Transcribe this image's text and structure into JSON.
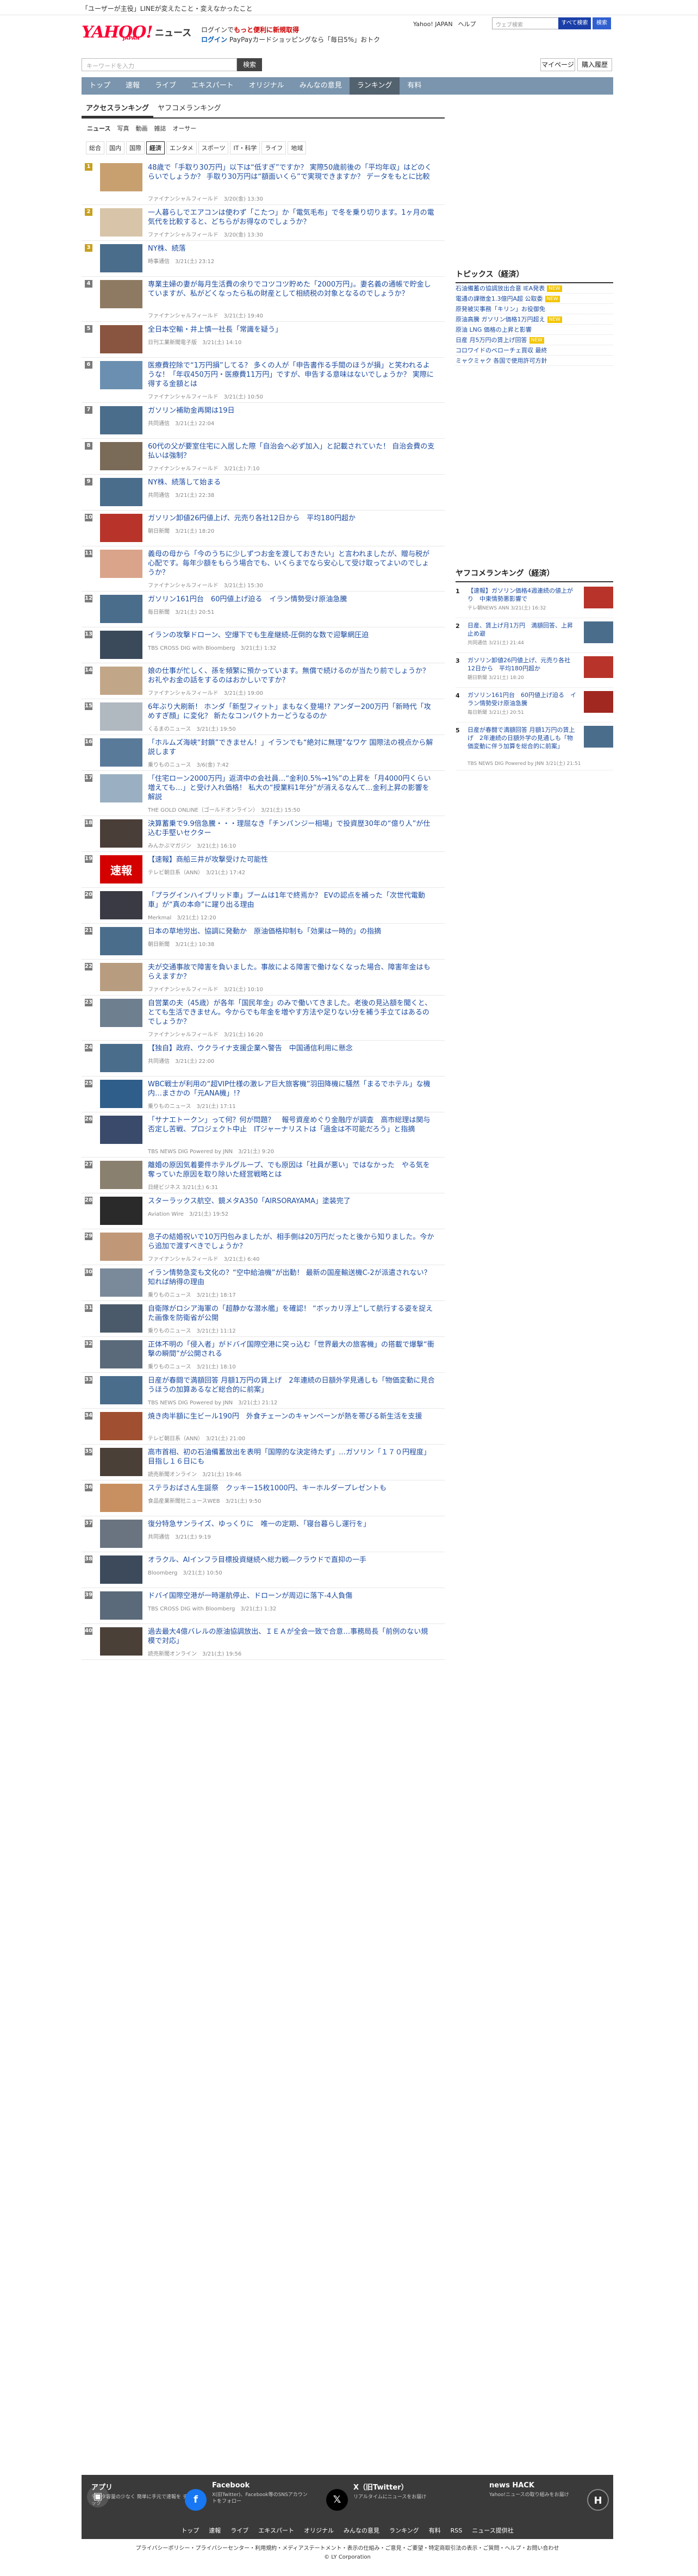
{
  "notice": "「ユーザーが主役」LINEが変えたこと・変えなかったこと",
  "header": {
    "logo": "YAHOO!",
    "logo_sub": "JAPAN",
    "service": "ニュース",
    "promo_line1_prefix": "ログインで",
    "promo_line1_highlight": "もっと便利に新規取得",
    "promo_line2_prefix": "ログイン",
    "promo_line2_rest": "PayPayカードショッピングなら「毎日5%」おトク",
    "links": [
      "Yahoo! JAPAN",
      "ヘルプ"
    ],
    "search_placeholder": "ウェブ検索",
    "search_btn": "すべて検索",
    "search_btn2": "検索"
  },
  "main_search": {
    "placeholder": "キーワードを入力",
    "button": "検索",
    "mypage": "マイページ",
    "subscribe": "購入履歴",
    "settings_icon": "gear-icon"
  },
  "nav": [
    {
      "label": "トップ",
      "on": false
    },
    {
      "label": "速報",
      "on": false
    },
    {
      "label": "ライブ",
      "on": false
    },
    {
      "label": "エキスパート",
      "on": false
    },
    {
      "label": "オリジナル",
      "on": false
    },
    {
      "label": "みんなの意見",
      "on": false
    },
    {
      "label": "ランキング",
      "on": true
    },
    {
      "label": "有料",
      "on": false
    }
  ],
  "subtabs": [
    {
      "label": "アクセスランキング",
      "on": true
    },
    {
      "label": "ヤフコメランキング",
      "on": false
    }
  ],
  "types": [
    {
      "label": "ニュース",
      "on": true
    },
    {
      "label": "写真",
      "on": false
    },
    {
      "label": "動画",
      "on": false
    },
    {
      "label": "雑誌",
      "on": false
    },
    {
      "label": "オーサー",
      "on": false
    }
  ],
  "cats": [
    {
      "label": "総合",
      "on": false
    },
    {
      "label": "国内",
      "on": false
    },
    {
      "label": "国際",
      "on": false
    },
    {
      "label": "経済",
      "on": true
    },
    {
      "label": "エンタメ",
      "on": false
    },
    {
      "label": "スポーツ",
      "on": false
    },
    {
      "label": "IT・科学",
      "on": false
    },
    {
      "label": "ライフ",
      "on": false
    },
    {
      "label": "地域",
      "on": false
    }
  ],
  "items": [
    {
      "rank": "1",
      "title": "48歳で「手取り30万円」以下は“低すぎ”ですか？ 実際50歳前後の「平均年収」はどのくらいでしょうか？ 手取り30万円は“額面いくら”で実現できますか？ データをもとに比較",
      "meta": "ファイナンシャルフィールド　3/20(金) 13:30",
      "color": "#c8a070"
    },
    {
      "rank": "2",
      "title": "一人暮らしでエアコンは使わず「こたつ」か「電気毛布」で冬を乗り切ります。1ヶ月の電気代を比較すると、どちらがお得なのでしょうか？",
      "meta": "ファイナンシャルフィールド　3/20(金) 13:30",
      "color": "#d8c4a8"
    },
    {
      "rank": "3",
      "title": "NY株、続落",
      "meta": "時事通信　3/21(土) 23:12",
      "color": "#4b6d8c"
    },
    {
      "rank": "4",
      "title": "専業主婦の妻が毎月生活費の余りでコツコツ貯めた「2000万円」。妻名義の通帳で貯金していますが、私がどくなったら私の財産として相続税の対象となるのでしょうか？",
      "meta": "ファイナンシャルフィールド　3/21(土) 19:40",
      "color": "#8e7a62"
    },
    {
      "rank": "5",
      "title": "全日本空輸・井上慎一社長「常識を疑う」",
      "meta": "日刊工業新聞電子版　3/21(土) 14:10",
      "color": "#8a5540"
    },
    {
      "rank": "6",
      "title": "医療費控除で“1万円損”してる？ 多くの人が「申告書作る手間のほうが損」と笑われるような！「年収450万円・医療費11万円」ですが、申告する意味はないでしょうか？ 実際に得する金額とは",
      "meta": "ファイナンシャルフィールド　3/21(土) 10:50",
      "color": "#6b8fb0"
    },
    {
      "rank": "7",
      "title": "ガソリン補助金再開は19日",
      "meta": "共同通信　3/21(土) 22:04",
      "color": "#4b6d8c"
    },
    {
      "rank": "8",
      "title": "60代の父が要室住宅に入居した際「自治会へ必ず加入」と記載されていた！ 自治会費の支払いは強制？",
      "meta": "ファイナンシャルフィールド　3/21(土) 7:10",
      "color": "#7a6a58"
    },
    {
      "rank": "9",
      "title": "NY株、続落して始まる",
      "meta": "共同通信　3/21(土) 22:38",
      "color": "#4b6d8c"
    },
    {
      "rank": "10",
      "title": "ガソリン卸値26円値上げ、元売り各社12日から　平均180円超か",
      "meta": "朝日新聞　3/21(土) 18:20",
      "color": "#b8342a"
    },
    {
      "rank": "11",
      "title": "義母の母から「今のうちに少しずつお金を渡しておきたい」と言われましたが、贈与税が心配です。毎年少額をもらう場合でも、いくらまでなら安心して受け取ってよいのでしょうか？",
      "meta": "ファイナンシャルフィールド　3/21(土) 15:30",
      "color": "#d9a48a"
    },
    {
      "rank": "12",
      "title": "ガソリン161円台　60円値上げ迫る　イラン情勢受け原油急騰",
      "meta": "毎日新聞　3/21(土) 20:51",
      "color": "#4b6d8c"
    },
    {
      "rank": "13",
      "title": "イランの攻撃ドローン、空爆下でも生産継続-圧倒的な数で迎撃網圧迫",
      "meta": "TBS CROSS DIG with Bloomberg　3/21(土) 1:32",
      "color": "#3a4a5a"
    },
    {
      "rank": "14",
      "title": "娘の仕事が忙しく、孫を頻繁に預かっています。無償で続けるのが当たり前でしょうか？ お礼やお金の話をするのはおかしいですか？",
      "meta": "ファイナンシャルフィールド　3/21(土) 19:00",
      "color": "#c2a688"
    },
    {
      "rank": "15",
      "title": "6年ぶり大刷新！ ホンダ「新型フィット」まもなく登場!? アンダー200万円「新時代「攻めすぎ顔」に変化？ 新たなコンパクトカーどうなるのか",
      "meta": "くるまのニュース　3/21(土) 19:50",
      "color": "#b0b8c0"
    },
    {
      "rank": "16",
      "title": "「ホルムズ海峡“封鎖”できません！」イランでも“絶対に無理”なワケ 国際法の視点から解説します",
      "meta": "乗りものニュース　3/6(金) 7:42",
      "color": "#5a7a9a"
    },
    {
      "rank": "17",
      "title": "「住宅ローン2000万円」返済中の会社員…“金利0.5%→1%”の上昇を「月4000円くらい増えても…」と受け入れ価格！ 私大の“授業料1年分”が消えるなんて…金利上昇の影響を解説",
      "meta": "THE GOLD ONLINE（ゴールドオンライン）　3/21(土) 15:50",
      "color": "#9ab0c2"
    },
    {
      "rank": "18",
      "title": "決算蓄乗で9.9倍急騰・・・理屈なき「チンパンジー相場」で投資歴30年の“億り人”が仕込む手堅いセクター",
      "meta": "みんかぶマガジン　3/21(土) 16:10",
      "color": "#4a3e38"
    },
    {
      "rank": "19",
      "title": "【速報】商船三井が攻撃受けた可能性",
      "meta": "テレビ朝日系（ANN）　3/21(土) 17:42",
      "color": "#d40000",
      "sokuho": true
    },
    {
      "rank": "20",
      "title": "「プラグインハイブリッド車」ブームは1年で終焉か？ EVの認点を補った「次世代電動車」が“真の本命”に躍り出る理由",
      "meta": "Merkmal　3/21(土) 12:20",
      "color": "#3a3a44"
    },
    {
      "rank": "21",
      "title": "日本の草地労出、協調に発動か　原油価格抑制も「効果は一時的」の指摘",
      "meta": "朝日新聞　3/21(土) 10:38",
      "color": "#4b6d8c"
    },
    {
      "rank": "22",
      "title": "夫が交通事故で障害を負いました。事故による障害で働けなくなった場合、障害年金はもらえますか？",
      "meta": "ファイナンシャルフィールド　3/21(土) 10:10",
      "color": "#b89c80"
    },
    {
      "rank": "23",
      "title": "自営業の夫（45歳）が各年「国民年金」のみで働いてきました。老後の見込額を聞くと、とても生活できません。今からでも年金を増やす方法や足りない分を補う手立てはあるのでしょうか？",
      "meta": "ファイナンシャルフィールド　3/21(土) 16:20",
      "color": "#6e7f90"
    },
    {
      "rank": "24",
      "title": "【独自】政府、ウクライナ支援企業へ警告　中国通信利用に懸念",
      "meta": "共同通信　3/21(土) 22:00",
      "color": "#4b6d8c"
    },
    {
      "rank": "25",
      "title": "WBC戦士が利用の“超VIP仕様の激レア巨大旅客機”羽田降機に騒然「まるでホテル」な機内…まさかの「元ANA機」!?",
      "meta": "乗りものニュース　3/21(土) 17:11",
      "color": "#2f5e8a"
    },
    {
      "rank": "26",
      "title": "「サナエトークン」って何？何が問題？　報号資産めぐり金融庁が調査　高市総理は関与否定し苦戦、プロジェクト中止　ITジャーナリストは「過金は不可能だろう」と指摘",
      "meta": "TBS NEWS DIG Powered by JNN　3/21(土) 9:20",
      "color": "#3a4a6a"
    },
    {
      "rank": "27",
      "title": "離婚の原因気着要件ホテルグループ、でも原因は「社員が悪い」ではなかった　やる気を奪っていた原因を取り除いた経営戦略とは",
      "meta": "日経ビジネス 3/21(土) 6:31",
      "color": "#8a8070"
    },
    {
      "rank": "28",
      "title": "スターラックス航空、鏡メタA350「AIRSORAYAMA」塗装完了",
      "meta": "Aviation Wire　3/21(土) 19:52",
      "color": "#2a2a2a"
    },
    {
      "rank": "29",
      "title": "息子の結婚祝いで10万円包みましたが、相手側は20万円だったと後から知りました。今から追加で渡すべきでしょうか？",
      "meta": "ファイナンシャルフィールド　3/21(土) 6:40",
      "color": "#c09878"
    },
    {
      "rank": "30",
      "title": "イラン情勢急変も文化の？“空中給油機”が出動！ 最新の国産輸送機C-2が派遣されない？ 知れば納得の理由",
      "meta": "乗りものニュース　3/21(土) 18:17",
      "color": "#7a8a9a"
    },
    {
      "rank": "31",
      "title": "自衛隊がロシア海軍の「超静かな潜水艦」を確認！ “ボッカリ浮上”して航行する姿を捉えた画像を防衛省が公開",
      "meta": "乗りものニュース　3/21(土) 11:12",
      "color": "#4a5a6a"
    },
    {
      "rank": "32",
      "title": "正体不明の「侵入者」がドバイ国際空港に突っ込む「世界最大の旅客機」の搭載で爆撃“衝撃の瞬間”が公開される",
      "meta": "乗りものニュース　3/21(土) 18:10",
      "color": "#5a6a7a"
    },
    {
      "rank": "33",
      "title": "日産が春闘で満額回答 月額1万円の賃上げ　2年連続の日額外学見通しも「物価変動に見合うほうの加算あるなど総合的に前案」",
      "meta": "TBS NEWS DIG Powered by JNN　3/21(土) 21:12",
      "color": "#4b6d8c"
    },
    {
      "rank": "34",
      "title": "焼き肉半額に生ビール190円　外食チェーンのキャンペーンが熱を帯びる新生活を支援",
      "meta": "テレビ朝日系（ANN）　3/21(土) 21:00",
      "color": "#a05030"
    },
    {
      "rank": "35",
      "title": "高市首相、初の石油備蓄放出を表明「国際的な決定待たず」…ガソリン「１７０円程度」目指し１６日にも",
      "meta": "読売新聞オンライン　3/21(土) 19:46",
      "color": "#4a4038"
    },
    {
      "rank": "36",
      "title": "ステラおばさん生誕祭　クッキー15枚1000円、キーホルダープレゼントも",
      "meta": "食品産業新聞社ニュースWEB　3/21(土) 9:50",
      "color": "#c89060"
    },
    {
      "rank": "37",
      "title": "復分特急サンライズ、ゆっくりに　唯一の定期、「寝台暮らし運行を」",
      "meta": "共同通信　3/21(土) 9:19",
      "color": "#6a7480"
    },
    {
      "rank": "38",
      "title": "オラクル、AIインフラ目標投資継続へ総力戦―クラウドで直抑の一手",
      "meta": "Bloomberg　3/21(土) 10:50",
      "color": "#3c4a5c"
    },
    {
      "rank": "39",
      "title": "ドバイ国際空港が一時運航停止、ドローンが周辺に落下-4人負傷",
      "meta": "TBS CROSS DIG with Bloomberg　3/21(土) 1:32",
      "color": "#5a6a7a"
    },
    {
      "rank": "40",
      "title": "過去最大4億バレルの原油協調放出、ＩＥＡが全会一致で合意…事務局長「前例のない規模で対応」",
      "meta": "読売新聞オンライン　3/21(土) 19:56",
      "color": "#4a4038"
    }
  ],
  "topics": {
    "heading": "トピックス（経済）",
    "items": [
      {
        "text": "石油備蓄の協調放出合意 IEA発表",
        "badge": "NEW"
      },
      {
        "text": "電通の課徴金1.3億円A超 公取委",
        "badge": "NEW"
      },
      {
        "text": "原発被災事務「キリン」お役御免",
        "badge": ""
      },
      {
        "text": "原油高騰 ガソリン価格1万円超え",
        "badge": "NEW"
      },
      {
        "text": "原油 LNG 価格の上昇と影響",
        "badge": ""
      },
      {
        "text": "日産 月5万円の賃上げ回答",
        "badge": "NEW"
      },
      {
        "text": "コロワイドのベローチェ買収 最終",
        "badge": ""
      },
      {
        "text": "ミャクミャク 各国で使用許可方針",
        "badge": ""
      }
    ]
  },
  "yafukome": {
    "heading": "ヤフコメランキング（経済）",
    "items": [
      {
        "rank": "1",
        "title": "【速報】ガソリン価格4週連続の値上がり　中東情勢悪影響で",
        "meta": "テレ朝NEWS ANN 3/21(土) 16:32",
        "color": "#b8342a"
      },
      {
        "rank": "2",
        "title": "日産、賃上げ月1万円　満額回答、上昇止め避",
        "meta": "共同通信 3/21(土) 21:44",
        "color": "#4b6d8c"
      },
      {
        "rank": "3",
        "title": "ガソリン卸値26円値上げ、元売り各社12日から　平均180円超か",
        "meta": "朝日新聞 3/21(土) 18:20",
        "color": "#b8342a"
      },
      {
        "rank": "4",
        "title": "ガソリン161円台　60円値上げ迫る　イラン情勢受け原油急騰",
        "meta": "毎日新聞 3/21(土) 20:51",
        "color": "#a02820"
      },
      {
        "rank": "5",
        "title": "日産が春闘で満額回答 月額1万円の賃上げ　2年連続の日額外学の見通しも「物価変動に伴う加算を総合的に前案」",
        "meta": "TBS NEWS DIG Powered by JNN 3/21(土) 21:51",
        "color": "#4b6d8c"
      }
    ]
  },
  "footer": {
    "app_title": "アプリ",
    "app_text": "データ容量の少なく 簡単に手元で速報を チェック",
    "facebook_title": "Facebook",
    "facebook_text": "X(旧Twitter)、Facebook等のSNSアカウントをフォロー",
    "x_title": "X（旧Twitter）",
    "x_text": "リアルタイムにニュースをお届け",
    "hack_title": "news HACK",
    "hack_text": "Yahoo!ニュースの取り組みをお届け",
    "nav": [
      "トップ",
      "速報",
      "ライブ",
      "エキスパート",
      "オリジナル",
      "みんなの意見",
      "ランキング",
      "有料",
      "RSS",
      "ニュース提供社"
    ],
    "links": "プライバシーポリシー・プライバシーセンター・利用規約・メディアステートメント・表示の仕組み・ご意見・ご要望・特定商取引法の表示・ご質問・ヘルプ・お問い合わせ",
    "copyright": "© LY Corporation"
  }
}
